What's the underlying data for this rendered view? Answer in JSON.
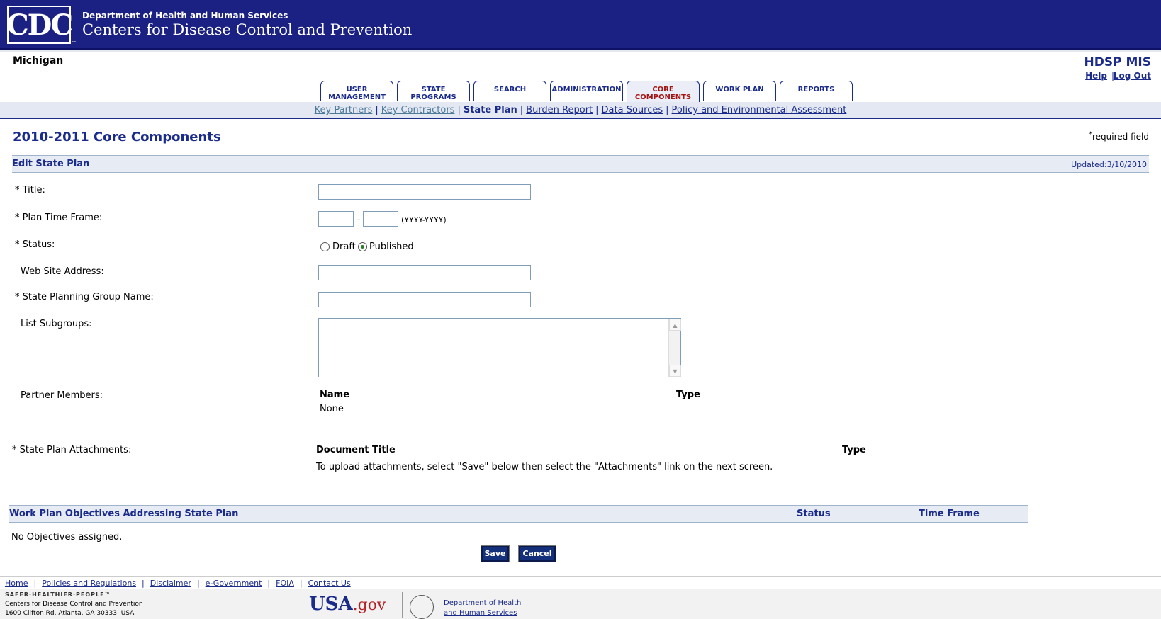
{
  "header": {
    "logo_text": "CDC",
    "logo_tm": "™",
    "department": "Department of Health and Human Services",
    "agency": "Centers for Disease Control and Prevention"
  },
  "state": "Michigan",
  "app_title": "HDSP MIS",
  "top_links": {
    "help": "Help",
    "separator": "|",
    "logout": "Log Out"
  },
  "tabs": [
    {
      "label_line1": "USER",
      "label_line2": "MANAGEMENT"
    },
    {
      "label_line1": "STATE",
      "label_line2": "PROGRAMS"
    },
    {
      "label_line1": "SEARCH",
      "label_line2": ""
    },
    {
      "label_line1": "ADMINISTRATION",
      "label_line2": ""
    },
    {
      "label_line1": "CORE",
      "label_line2": "COMPONENTS",
      "active": true
    },
    {
      "label_line1": "WORK PLAN",
      "label_line2": ""
    },
    {
      "label_line1": "REPORTS",
      "label_line2": ""
    }
  ],
  "subnav": {
    "items": [
      "Key Partners",
      "Key Contractors",
      "State Plan",
      "Burden Report",
      "Data Sources",
      "Policy and Environmental Assessment"
    ],
    "current": "State Plan"
  },
  "page_title": "2010-2011 Core Components",
  "required_note": {
    "star": "*",
    "text": "required field"
  },
  "section": {
    "title": "Edit State Plan",
    "updated": "Updated:3/10/2010"
  },
  "form": {
    "title_label": "* Title:",
    "title_value": "",
    "time_frame_label": "* Plan Time Frame:",
    "time_frame_start": "",
    "time_frame_dash": "-",
    "time_frame_end": "",
    "time_frame_hint": "(YYYY-YYYY)",
    "status_label": "* Status:",
    "status_options": [
      "Draft",
      "Published"
    ],
    "status_selected": "Published",
    "website_label": "Web Site Address:",
    "website_value": "",
    "planning_group_label": "* State Planning Group Name:",
    "planning_group_value": "",
    "subgroups_label": "List Subgroups:",
    "subgroups_value": "",
    "partner_members_label": "Partner Members:",
    "partner_columns": [
      "Name",
      "Type"
    ],
    "partner_empty": "None",
    "attachments_label": "* State Plan Attachments:",
    "attachment_columns": [
      "Document Title",
      "Type"
    ],
    "attachment_note": "To upload attachments, select \"Save\" below then select the \"Attachments\" link on the next screen."
  },
  "objectives": {
    "columns": [
      "Work Plan Objectives Addressing State Plan",
      "Status",
      "Time Frame"
    ],
    "empty": "No Objectives assigned."
  },
  "buttons": {
    "save": "Save",
    "cancel": "Cancel"
  },
  "footer": {
    "links": [
      "Home",
      "Policies and Regulations",
      "Disclaimer",
      "e-Government",
      "FOIA",
      "Contact Us"
    ],
    "shp": "SAFER·HEALTHIER·PEOPLE™",
    "address_line1": "Centers for Disease Control and Prevention",
    "address_line2": "1600 Clifton Rd. Atlanta, GA 30333, USA",
    "usagov_usa": "USA",
    "usagov_gov": ".gov",
    "hhs_line1": "Department of Health",
    "hhs_line2": "and Human Services"
  },
  "colors": {
    "banner": "#1a2182",
    "link": "#1a2b8a",
    "active_tab_text": "#a31515",
    "section_bg": "#e6ebf4"
  }
}
